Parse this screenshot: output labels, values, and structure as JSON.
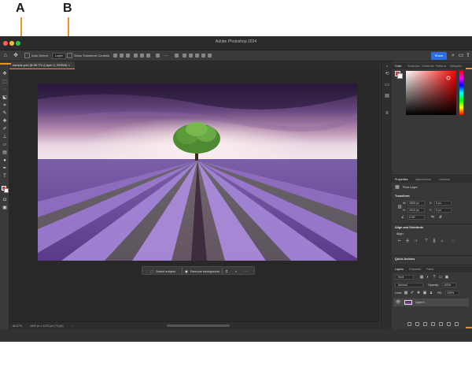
{
  "callouts": {
    "a": "A",
    "b": "B"
  },
  "window": {
    "title": "Adobe Photoshop 2024",
    "traffic_colors": [
      "#ff5f57",
      "#febc2e",
      "#28c840"
    ]
  },
  "options_bar": {
    "auto_select_label": "Auto-Select:",
    "auto_select_value": "Layer",
    "show_transform_label": "Show Transform Controls",
    "share_label": "Share"
  },
  "document": {
    "tab_label": "sample.psd @ 66.7% (Layer 0, RGB/8)"
  },
  "context_bar": {
    "select_subject": "Select subject",
    "remove_background": "Remove background",
    "more": "···"
  },
  "status_bar": {
    "zoom": "66.67%",
    "dimensions": "1800 px x 1013 px (72 ppi)"
  },
  "color_panel": {
    "tabs": [
      "Color",
      "Swatches",
      "Gradients",
      "Patterns",
      "Navigator"
    ],
    "active_tab": "Color",
    "foreground_color": "#d63b3b",
    "background_color": "#ffffff"
  },
  "properties_panel": {
    "tabs": [
      "Properties",
      "Adjustments",
      "Libraries"
    ],
    "active_tab": "Properties",
    "layer_type": "Pixel Layer",
    "transform_title": "Transform",
    "w_label": "W",
    "w_value": "1800 px",
    "h_label": "H",
    "h_value": "1013 px",
    "x_label": "X",
    "x_value": "0 px",
    "y_label": "Y",
    "y_value": "0 px",
    "angle_value": "0.00°",
    "align_title": "Align and Distribute",
    "align_label": "Align:",
    "quick_actions_title": "Quick Actions"
  },
  "layers_panel": {
    "tabs": [
      "Layers",
      "Channels",
      "Paths"
    ],
    "active_tab": "Layers",
    "kind_label": "Kind",
    "blend_mode": "Normal",
    "opacity_label": "Opacity:",
    "opacity_value": "100%",
    "lock_label": "Lock:",
    "fill_label": "Fill:",
    "fill_value": "100%",
    "layers": [
      {
        "name": "Layer 0",
        "visible": true,
        "selected": true
      }
    ]
  },
  "accent_colors": {
    "callout_orange": "#e8932a",
    "share_blue": "#2d6fe0"
  }
}
